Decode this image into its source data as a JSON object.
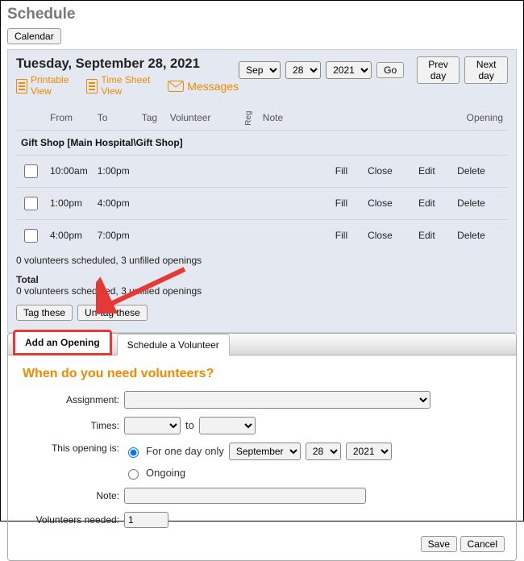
{
  "title": "Schedule",
  "calendar_btn": "Calendar",
  "date": "Tuesday, September 28, 2021",
  "links": {
    "printable": "Printable\nView",
    "timesheet": "Time Sheet\nView",
    "messages": "Messages"
  },
  "nav": {
    "month": "Sep",
    "day": "28",
    "year": "2021",
    "go": "Go",
    "prev": "Prev day",
    "next": "Next day"
  },
  "cols": {
    "from": "From",
    "to": "To",
    "tag": "Tag",
    "volunteer": "Volunteer",
    "reg": "Reg",
    "note": "Note",
    "opening": "Opening"
  },
  "group": "Gift Shop [Main Hospital\\Gift Shop]",
  "rows": [
    {
      "from": "10:00am",
      "to": "1:00pm"
    },
    {
      "from": "1:00pm",
      "to": "4:00pm"
    },
    {
      "from": "4:00pm",
      "to": "7:00pm"
    }
  ],
  "actions": {
    "fill": "Fill",
    "close": "Close",
    "edit": "Edit",
    "delete": "Delete"
  },
  "summary1": "0 volunteers scheduled, 3 unfilled openings",
  "total_label": "Total",
  "summary2": "0 volunteers scheduled, 3 unfilled openings",
  "tag_btns": {
    "tag": "Tag these",
    "untag": "Un-tag these"
  },
  "tabs": {
    "add": "Add an Opening",
    "sched": "Schedule a Volunteer"
  },
  "form": {
    "heading": "When do you need volunteers?",
    "assignment_lbl": "Assignment:",
    "times_lbl": "Times:",
    "times_to": "to",
    "opening_lbl": "This opening is:",
    "for_one_day": "For one day only",
    "ongoing": "Ongoing",
    "month": "September",
    "day": "28",
    "year": "2021",
    "note_lbl": "Note:",
    "vol_needed_lbl": "Volunteers needed:",
    "vol_needed_val": "1",
    "save": "Save",
    "cancel": "Cancel"
  }
}
